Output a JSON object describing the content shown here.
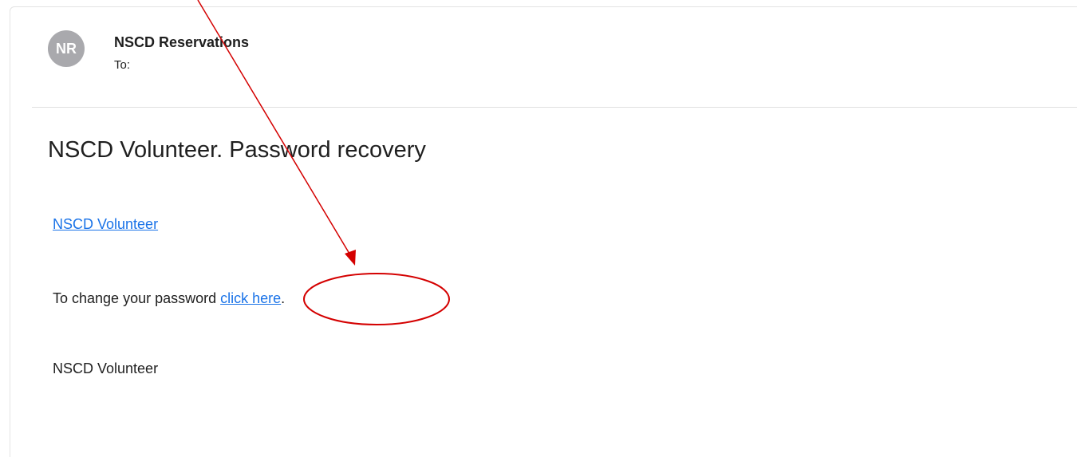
{
  "email": {
    "avatar_initials": "NR",
    "sender": "NSCD Reservations",
    "to_label": "To:",
    "subject": "NSCD Volunteer. Password recovery",
    "site_link": "NSCD Volunteer",
    "body_prefix": "To change your password ",
    "body_link": "click here",
    "body_suffix": ".",
    "signature": "NSCD Volunteer"
  },
  "colors": {
    "link": "#1a73e8",
    "annotation": "#d40000",
    "avatar": "#a9a9ad"
  }
}
